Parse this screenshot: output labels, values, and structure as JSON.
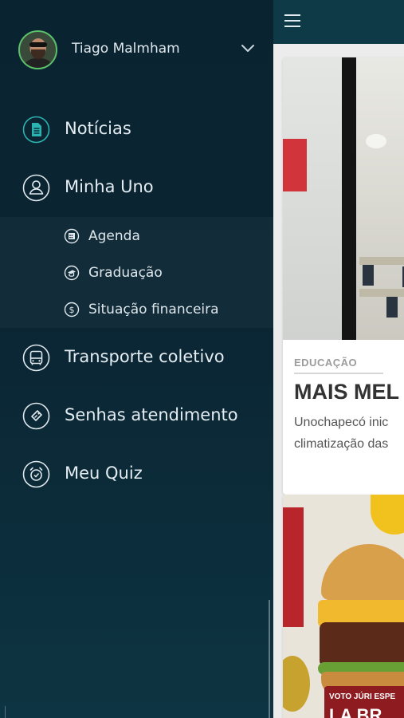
{
  "user": {
    "name": "Tiago Malmham",
    "avatar_icon": "user-photo",
    "expand_icon": "chevron-down-icon"
  },
  "menu": {
    "items": [
      {
        "label": "Notícias",
        "icon": "news-icon",
        "active": true
      },
      {
        "label": "Minha Uno",
        "icon": "user-circle-icon"
      },
      {
        "label": "Transporte coletivo",
        "icon": "bus-icon"
      },
      {
        "label": "Senhas atendimento",
        "icon": "ticket-icon"
      },
      {
        "label": "Meu Quiz",
        "icon": "alarm-clock-icon"
      }
    ],
    "submenu": [
      {
        "label": "Agenda",
        "icon": "calendar-icon"
      },
      {
        "label": "Graduação",
        "icon": "graduation-cap-icon"
      },
      {
        "label": "Situação financeira",
        "icon": "dollar-icon"
      }
    ]
  },
  "feed": {
    "menu_icon": "hamburger-icon",
    "cards": [
      {
        "category": "EDUCAÇÃO",
        "title": "MAIS MEL",
        "body_line1": "Unochapecó inic",
        "body_line2": "climatização das"
      },
      {
        "promo_text": "VOTO JÚRI ESPE",
        "promo_text2": "LA BR"
      }
    ]
  },
  "colors": {
    "accent_green": "#5ac06a",
    "active_icon": "#2ab3b0",
    "drawer_bg": "#0b2533",
    "topbar": "#0e3a48"
  }
}
